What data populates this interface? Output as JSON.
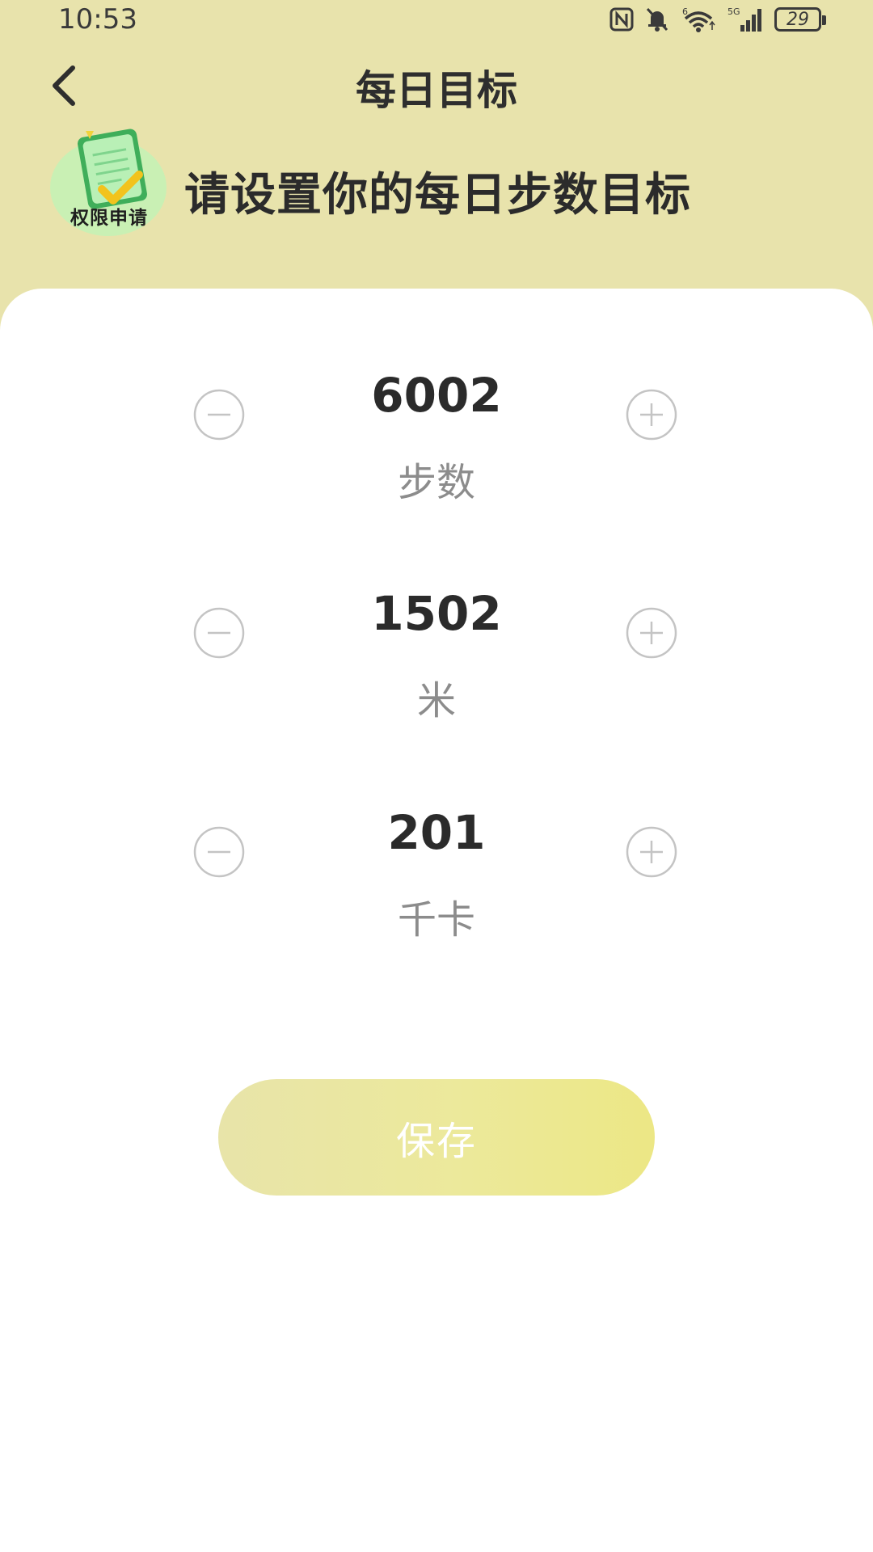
{
  "status_bar": {
    "time": "10:53",
    "battery_level": "29",
    "icons": [
      "nfc-icon",
      "bell-off-icon",
      "wifi-6-icon",
      "signal-5g-icon",
      "battery-icon"
    ]
  },
  "header": {
    "title": "每日目标",
    "back_icon": "chevron-left-icon"
  },
  "prompt": {
    "badge_text": "权限申请",
    "text": "请设置你的每日步数目标"
  },
  "goals": [
    {
      "value": "6002",
      "unit": "步数"
    },
    {
      "value": "1502",
      "unit": "米"
    },
    {
      "value": "201",
      "unit": "千卡"
    }
  ],
  "save_button": {
    "label": "保存"
  },
  "colors": {
    "header_bg": "#e8e3ac",
    "button_start": "#e8e4a9",
    "button_end": "#ece785",
    "icon_stroke": "#c4c4c4"
  }
}
